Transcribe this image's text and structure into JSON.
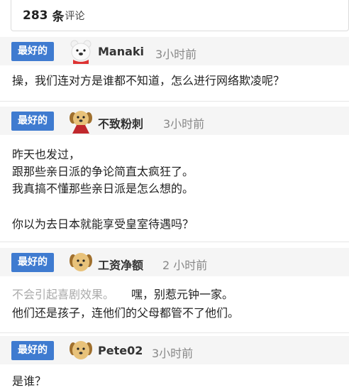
{
  "header": {
    "count": "283",
    "count_unit": "条",
    "count_word": "评论"
  },
  "comments": [
    {
      "badge": "最好的",
      "avatar_icon": "bear-avatar-icon",
      "username": "Manaki",
      "time": "3小时前",
      "lines": [
        "操，我们连对方是谁都不知道，怎么进行网络欺凌呢？"
      ]
    },
    {
      "badge": "最好的",
      "avatar_icon": "dog-avatar-icon",
      "username": "不致粉刺",
      "time": "3小时前",
      "lines": [
        "昨天也发过，",
        "跟那些亲日派的争论简直太疯狂了。",
        "我真搞不懂那些亲日派是怎么想的。",
        "",
        "你以为去日本就能享受皇室待遇吗？"
      ]
    },
    {
      "badge": "最好的",
      "avatar_icon": "dog-avatar-icon",
      "username": "工资净额",
      "time": "2 小时前",
      "lines_faded": "不会引起喜剧效果。",
      "lines": [
        "嘿，别惹元钟一家。",
        "他们还是孩子，连他们的父母都管不了他们。"
      ]
    },
    {
      "badge": "最好的",
      "avatar_icon": "dog-avatar-icon",
      "username": "Pete02",
      "time": "3小时前",
      "lines": [
        "是谁？"
      ]
    }
  ],
  "colors": {
    "badge_bg": "#3f7bd0",
    "header_bg": "#f5f5f5",
    "time_text": "#888888"
  }
}
